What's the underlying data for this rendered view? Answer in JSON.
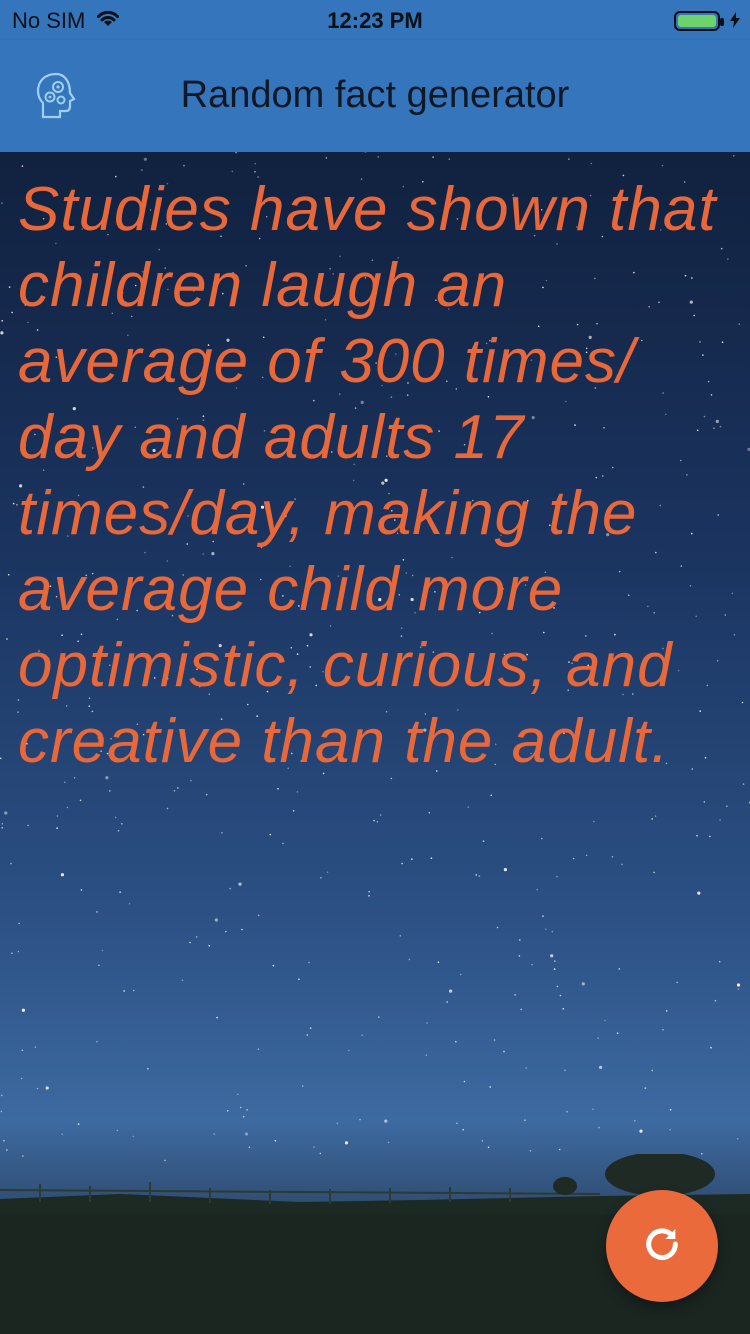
{
  "status_bar": {
    "carrier": "No SIM",
    "time": "12:23 PM",
    "wifi_icon": "wifi-icon",
    "battery_icon": "battery-icon",
    "charging_icon": "bolt-icon",
    "battery_color": "#6dd36b"
  },
  "app_bar": {
    "title": "Random fact generator",
    "icon": "brain-gear-icon",
    "background_color": "#3475bb"
  },
  "fact": {
    "text": "Studies have shown that children laugh an average of 300 times/ day and adults 17 times/day, making the average child more optimistic, curious, and creative than the adult.",
    "color": "#e8683a"
  },
  "refresh_button": {
    "icon": "refresh-icon",
    "color": "#eb6a3b"
  }
}
